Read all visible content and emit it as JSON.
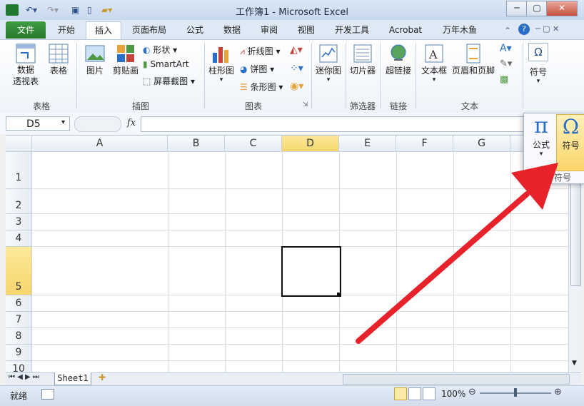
{
  "title": "工作簿1 - Microsoft Excel",
  "tabs": [
    "文件",
    "开始",
    "插入",
    "页面布局",
    "公式",
    "数据",
    "审阅",
    "视图",
    "开发工具",
    "Acrobat",
    "万年木鱼"
  ],
  "ribbon": {
    "pivot": "数据\n透视表",
    "table": "表格",
    "picture": "图片",
    "clipart": "剪贴画",
    "shapes": "形状",
    "smartart": "SmartArt",
    "screenshot": "屏幕截图",
    "column": "柱形图",
    "line": "折线图",
    "pie": "饼图",
    "bar": "条形图",
    "sparkline": "迷你图",
    "slicer": "切片器",
    "hyperlink": "超链接",
    "textbox": "文本框",
    "header": "页眉和页脚",
    "symbol": "符号",
    "groups": [
      "表格",
      "插图",
      "图表",
      "筛选器",
      "链接",
      "文本"
    ]
  },
  "namebox": "D5",
  "columns": [
    "A",
    "B",
    "C",
    "D",
    "E",
    "F",
    "G"
  ],
  "rows": [
    "1",
    "2",
    "3",
    "4",
    "5",
    "6",
    "7",
    "8",
    "9",
    "10"
  ],
  "selected_cell": "D5",
  "sheet": "Sheet1",
  "status": {
    "ready": "就绪",
    "zoom": "100%"
  },
  "popup": {
    "formula": "公式",
    "symbol": "符号",
    "group": "符号"
  },
  "colors": {
    "file_tab": "#2a7a2e",
    "selection": "#f7d66d",
    "arrow": "#e8222a"
  }
}
